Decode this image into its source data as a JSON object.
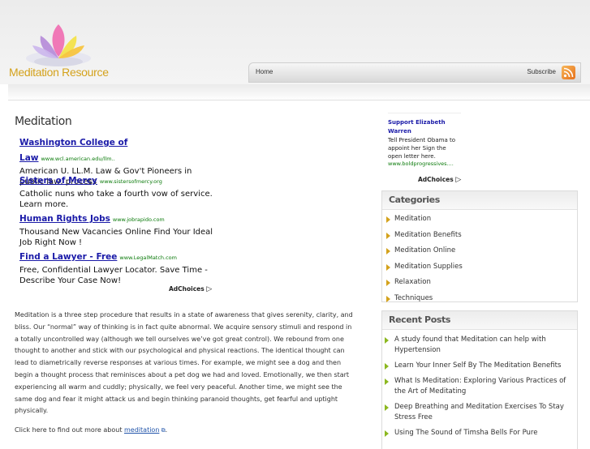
{
  "site": {
    "name": "Meditation Resource",
    "accent": "#d4a21c"
  },
  "nav": {
    "home": "Home",
    "subscribe": "Subscribe"
  },
  "main": {
    "title": "Meditation",
    "ads": [
      {
        "title": "Washington College of Law",
        "url": "www.wcl.american.edu/llm..",
        "desc": "American U. LL.M. Law & Gov't Pioneers in public law, process"
      },
      {
        "title": "Sisters of Mercy",
        "url": "www.sistersofmercy.org",
        "desc": "Catholic nuns who take a fourth vow of service. Learn more."
      },
      {
        "title": "Human Rights Jobs",
        "url": "www.jobrapido.com",
        "desc": "Thousand New Vacancies Online Find Your Ideal Job Right Now !"
      },
      {
        "title": "Find a Lawyer - Free",
        "url": "www.LegalMatch.com",
        "desc": "Free, Confidential Lawyer Locator. Save Time - Describe Your Case Now!"
      }
    ],
    "adchoices": "AdChoices",
    "body": "Meditation is a three step procedure that results in a state of awareness that gives serenity, clarity, and bliss. Our “normal” way of thinking is in fact quite abnormal. We acquire sensory stimuli and respond in a totally uncontrolled way (although we tell ourselves we’ve got great control). We rebound from one thought to another and stick with our psychological and physical reactions. The identical thought can lead to diametrically reverse responses at various times. For example, we might see a dog and then begin a thought process that reminisces about a pet dog we had and loved. Emotionally, we then start experiencing all warm and cuddly; physically, we feel very peaceful. Another time, we might see the same dog and fear it might attack us and begin thinking paranoid thoughts, get fearful and uptight physically.",
    "more_prefix": "Click here to find out more about ",
    "more_link": "meditation"
  },
  "sidebar": {
    "ad": {
      "title": "Support Elizabeth Warren",
      "text": "Tell President Obama to appoint her Sign the open letter here.",
      "url": "www.boldprogressives....",
      "adchoices": "AdChoices"
    },
    "categories": {
      "heading": "Categories",
      "items": [
        "Meditation",
        "Meditation Benefits",
        "Meditation Online",
        "Meditation Supplies",
        "Relaxation",
        "Techniques"
      ]
    },
    "recent": {
      "heading": "Recent Posts",
      "items": [
        "A study found that Meditation can help with Hypertension",
        "Learn Your Inner Self By The Meditation Benefits",
        "What Is Meditation: Exploring Various Practices of the Art of Meditating",
        "Deep Breathing and Meditation Exercises To Stay Stress Free",
        "Using The Sound of Timsha Bells For Pure"
      ]
    }
  }
}
